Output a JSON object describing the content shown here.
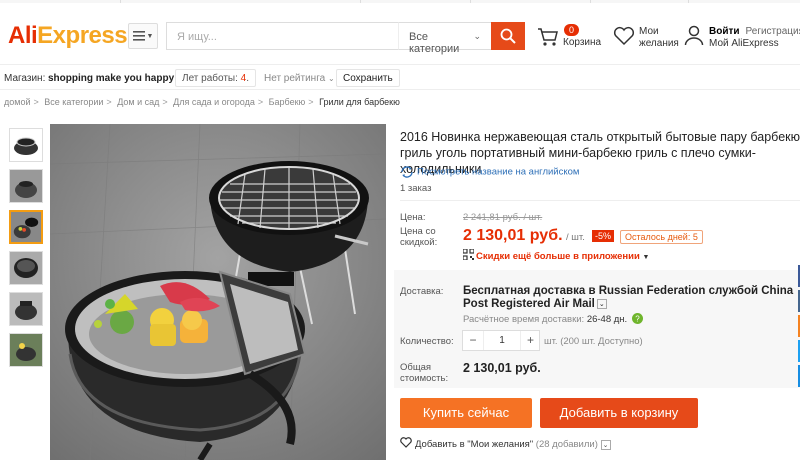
{
  "header": {
    "logo_part1": "Ali",
    "logo_part2": "Express",
    "search_placeholder": "Я ищу...",
    "search_category": "Все категории",
    "cart_count": "0",
    "cart_label": "Корзина",
    "wishlist_label": "Мои желания",
    "login_label": "Войти",
    "register_label": "Регистрация",
    "account_label": "Мой AliExpress"
  },
  "store": {
    "label": "Магазин:",
    "name": "shopping make you happy",
    "years_label": "Лет работы:",
    "years_value": "4",
    "rating": "Нет рейтинга",
    "save": "Сохранить"
  },
  "breadcrumbs": [
    "домой",
    "Все категории",
    "Дом и сад",
    "Для сада и огорода",
    "Барбекю",
    "Грили для барбекю"
  ],
  "product": {
    "title": "2016 Новинка нержавеющая сталь открытый бытовые пару барбекю гриль уголь портативный мини-барбекю гриль с плечо сумки-холодильники",
    "translate_link": "Посмотреть название на английском",
    "orders": "1 заказ",
    "price_label": "Цена:",
    "old_price": "2 241,81 руб. / шт.",
    "sale_label": "Цена со скидкой:",
    "price": "2 130,01 руб.",
    "unit": "/ шт.",
    "discount": "-5%",
    "days_left": "Осталось дней: 5",
    "app_promo": "Скидки ещё больше в приложении",
    "shipping_label": "Доставка:",
    "shipping": "Бесплатная доставка в Russian Federation службой China Post Registered Air Mail",
    "eta_label": "Расчётное время доставки:",
    "eta_value": "26-48",
    "eta_unit": "дн.",
    "qty_label": "Количество:",
    "qty_minus": "−",
    "qty_value": "1",
    "qty_plus": "+",
    "qty_note": "шт. (200 шт. Доступно)",
    "total_label": "Общая стоимость:",
    "total": "2 130,01 руб.",
    "buy_now": "Купить сейчас",
    "add_to_cart": "Добавить в корзину",
    "wishlist_add": "Добавить в \"Мои желания\"",
    "wishlist_count": "(28 добавили)"
  },
  "colors": {
    "brand_red": "#e62e04",
    "brand_orange": "#f57224",
    "link_blue": "#2d6fb7"
  }
}
